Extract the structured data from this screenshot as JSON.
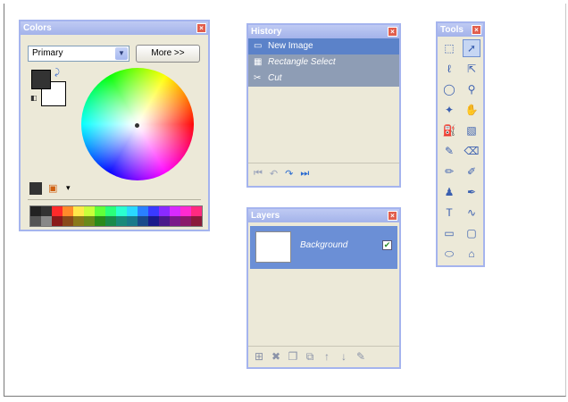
{
  "colors_panel": {
    "title": "Colors",
    "close": "×",
    "mode_select": "Primary",
    "more_button": "More >>",
    "palette": [
      "#222222",
      "#333333",
      "#ff2a2a",
      "#ff8a2a",
      "#ffe84a",
      "#c8ff3a",
      "#60ff3a",
      "#2aff7a",
      "#2affd0",
      "#2ad8ff",
      "#2a80ff",
      "#3a3aff",
      "#8a2aff",
      "#d82aff",
      "#ff2ad0",
      "#ff2a80",
      "#555555",
      "#888888",
      "#8a1a1a",
      "#8a4a1a",
      "#8a7a1a",
      "#6a8a1a",
      "#2a8a1a",
      "#1a8a4a",
      "#1a8a7a",
      "#1a7a8a",
      "#1a4a8a",
      "#1a1a8a",
      "#4a1a8a",
      "#7a1a8a",
      "#8a1a6a",
      "#8a1a3a"
    ]
  },
  "history_panel": {
    "title": "History",
    "close": "×",
    "items": [
      {
        "label": "New Image",
        "icon": "new-image-icon",
        "glyph": "▭"
      },
      {
        "label": "Rectangle Select",
        "icon": "rectangle-select-icon",
        "glyph": "▦"
      },
      {
        "label": "Cut",
        "icon": "scissors-icon",
        "glyph": "✂"
      }
    ]
  },
  "layers_panel": {
    "title": "Layers",
    "close": "×",
    "layer_name": "Background",
    "check": "✔"
  },
  "tools_panel": {
    "title": "Tools",
    "close": "×"
  }
}
